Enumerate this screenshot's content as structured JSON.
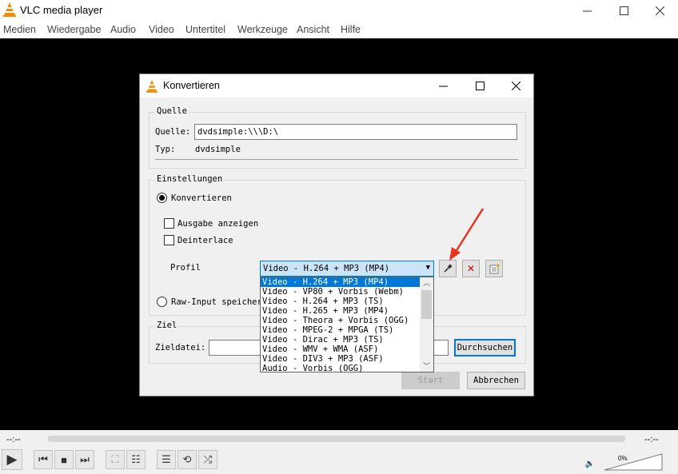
{
  "app": {
    "title": "VLC media player"
  },
  "menu": [
    "Medien",
    "Wiedergabe",
    "Audio",
    "Video",
    "Untertitel",
    "Werkzeuge",
    "Ansicht",
    "Hilfe"
  ],
  "dialog": {
    "title": "Konvertieren",
    "source": {
      "group": "Quelle",
      "label": "Quelle:",
      "value": "dvdsimple:\\\\\\D:\\",
      "type_label": "Typ:",
      "type_value": "dvdsimple"
    },
    "settings": {
      "group": "Einstellungen",
      "convert": "Konvertieren",
      "show_output": "Ausgabe anzeigen",
      "deinterlace": "Deinterlace",
      "profile_label": "Profil",
      "profile_selected": "Video - H.264 + MP3 (MP4)",
      "raw_input": "Raw-Input speichern"
    },
    "profiles": [
      "Video - H.264 + MP3 (MP4)",
      "Video - VP80 + Vorbis (Webm)",
      "Video - H.264 + MP3 (TS)",
      "Video - H.265 + MP3 (MP4)",
      "Video - Theora + Vorbis (OGG)",
      "Video - MPEG-2 + MPGA (TS)",
      "Video - Dirac + MP3 (TS)",
      "Video - WMV + WMA (ASF)",
      "Video - DIV3 + MP3 (ASF)",
      "Audio - Vorbis (OGG)"
    ],
    "target": {
      "group": "Ziel",
      "label": "Zieldatei:",
      "browse": "Durchsuchen"
    },
    "start": "Start",
    "cancel": "Abbrechen"
  },
  "player": {
    "time_left": "--:--",
    "time_right": "--:--",
    "volume": "0%"
  },
  "colors": {
    "accent": "#0078d7",
    "annotation": "#e8341c",
    "vlc_orange": "#f08a00"
  }
}
